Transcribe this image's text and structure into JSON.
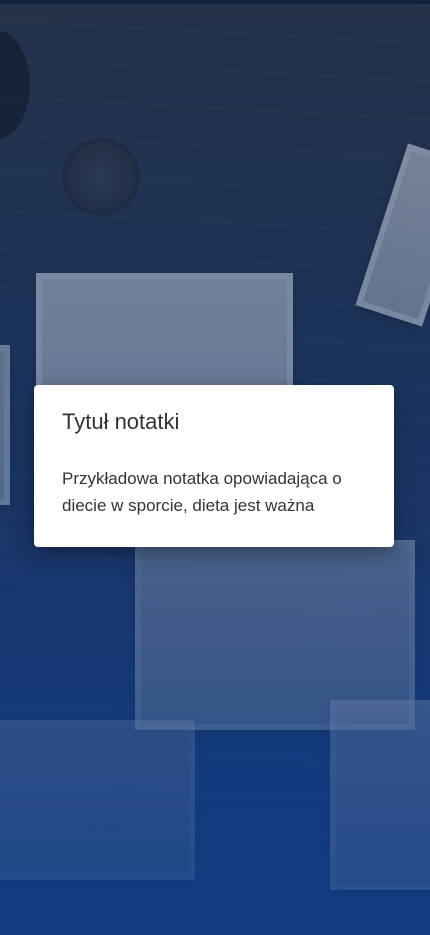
{
  "note": {
    "title": "Tytuł notatki",
    "body": "Przykładowa notatka opowiadająca o diecie w sporcie, dieta jest ważna"
  }
}
